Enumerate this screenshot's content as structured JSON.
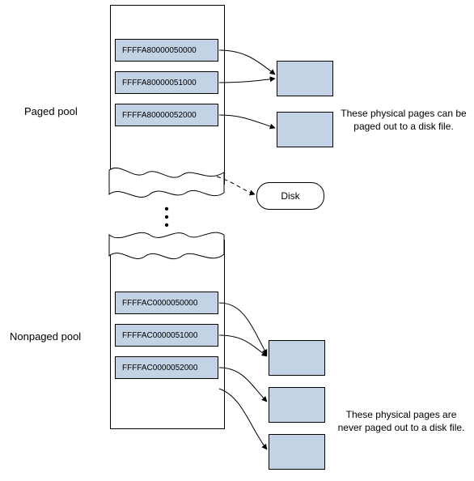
{
  "paged": {
    "title": "Paged pool",
    "cells": [
      "FFFFA80000050000",
      "FFFFA80000051000",
      "FFFFA80000052000"
    ],
    "note": "These physical pages can be\npaged out to a disk file.",
    "disk_label": "Disk"
  },
  "nonpaged": {
    "title": "Nonpaged pool",
    "cells": [
      "FFFFAC0000050000",
      "FFFFAC0000051000",
      "FFFFAC0000052000"
    ],
    "note": "These physical pages are\nnever paged out to a disk file."
  }
}
